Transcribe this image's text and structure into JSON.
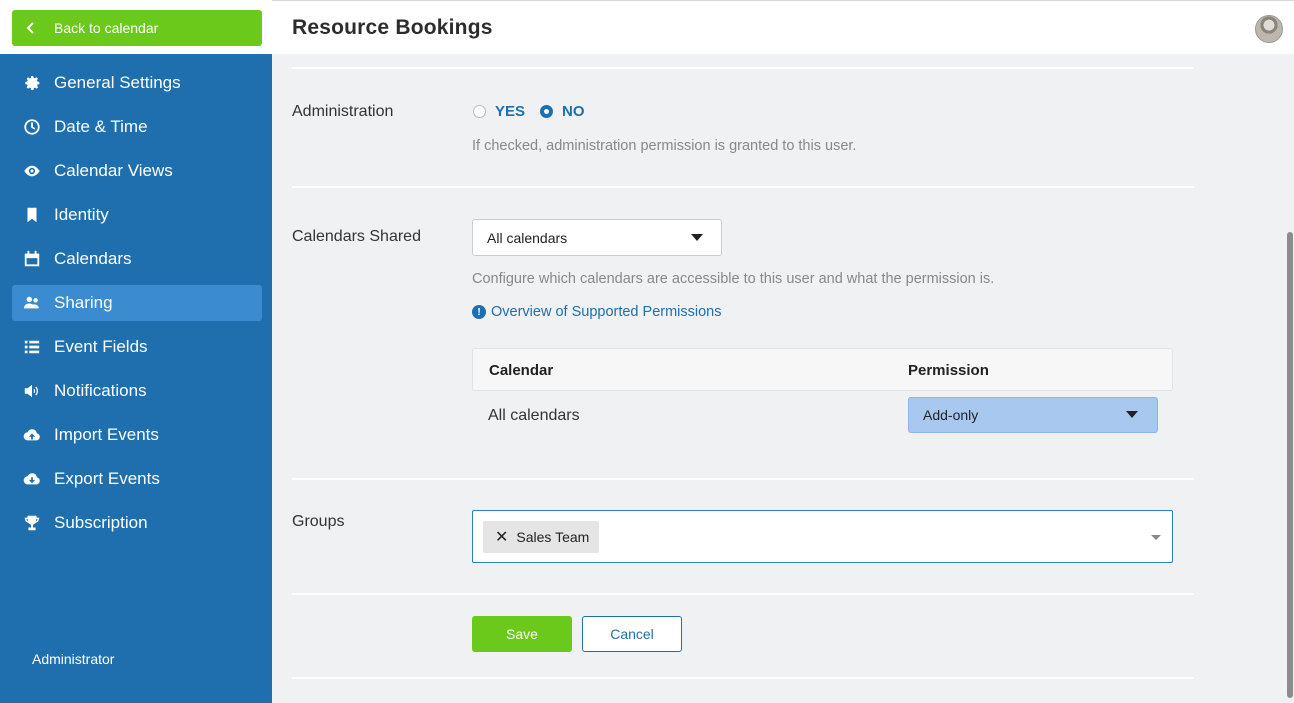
{
  "sidebar": {
    "back_label": "Back to calendar",
    "items": [
      {
        "label": "General Settings",
        "icon": "gear-icon"
      },
      {
        "label": "Date & Time",
        "icon": "clock-icon"
      },
      {
        "label": "Calendar Views",
        "icon": "eye-icon"
      },
      {
        "label": "Identity",
        "icon": "bookmark-icon"
      },
      {
        "label": "Calendars",
        "icon": "calendar-icon"
      },
      {
        "label": "Sharing",
        "icon": "users-icon",
        "active": true
      },
      {
        "label": "Event Fields",
        "icon": "list-icon"
      },
      {
        "label": "Notifications",
        "icon": "megaphone-icon"
      },
      {
        "label": "Import Events",
        "icon": "cloud-upload-icon"
      },
      {
        "label": "Export Events",
        "icon": "cloud-download-icon"
      },
      {
        "label": "Subscription",
        "icon": "trophy-icon"
      }
    ],
    "footer": "Administrator"
  },
  "header": {
    "title": "Resource Bookings"
  },
  "form": {
    "administration": {
      "label": "Administration",
      "options": [
        "YES",
        "NO"
      ],
      "selected": "NO",
      "help": "If checked, administration permission is granted to this user."
    },
    "calendars_shared": {
      "label": "Calendars Shared",
      "value": "All calendars",
      "help": "Configure which calendars are accessible to this user and what the permission is.",
      "link": "Overview of Supported Permissions",
      "table": {
        "headers": [
          "Calendar",
          "Permission"
        ],
        "rows": [
          {
            "calendar": "All calendars",
            "permission": "Add-only"
          }
        ]
      }
    },
    "groups": {
      "label": "Groups",
      "tags": [
        "Sales Team"
      ]
    },
    "save_label": "Save",
    "cancel_label": "Cancel"
  },
  "colors": {
    "sidebar": "#1f6fae",
    "active": "#3a8bd0",
    "accent_green": "#6bc91c",
    "link_blue": "#1f6fae"
  }
}
